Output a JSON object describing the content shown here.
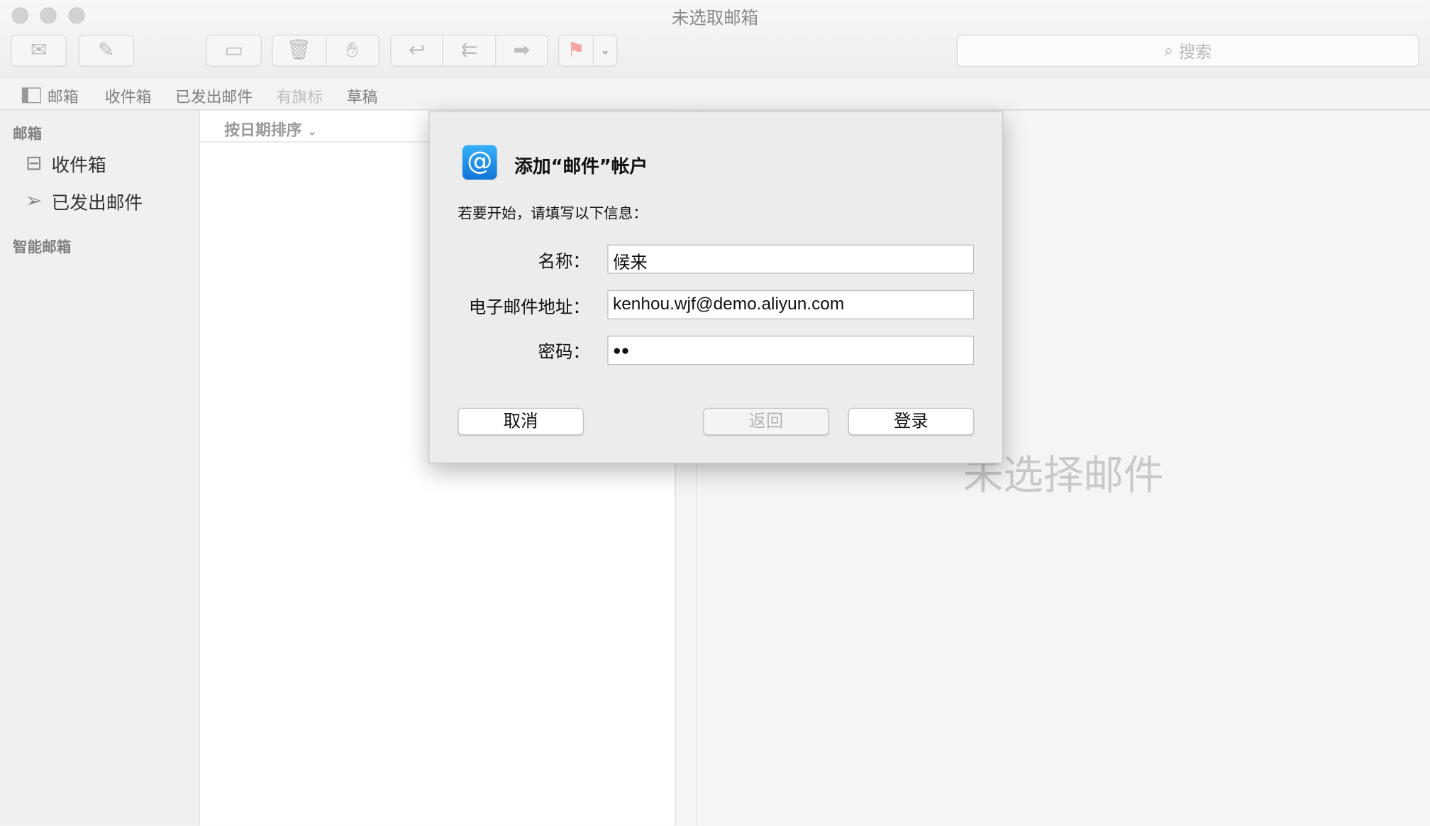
{
  "window": {
    "title": "未选取邮箱"
  },
  "toolbar": {
    "search_placeholder": "搜索",
    "flag_color": "#f26b6b"
  },
  "favorites": {
    "items": [
      {
        "label": "邮箱"
      },
      {
        "label": "收件箱"
      },
      {
        "label": "已发出邮件"
      },
      {
        "label": "有旗标"
      },
      {
        "label": "草稿"
      }
    ]
  },
  "sidebar": {
    "section_mailboxes": "邮箱",
    "items": [
      {
        "label": "收件箱"
      },
      {
        "label": "已发出邮件"
      }
    ],
    "section_smart": "智能邮箱"
  },
  "list": {
    "sort_label": "按日期排序"
  },
  "reader": {
    "empty_text": "未选择邮件"
  },
  "dialog": {
    "title": "添加“邮件”帐户",
    "subtitle": "若要开始，请填写以下信息：",
    "fields": [
      {
        "label": "名称：",
        "value": "候来"
      },
      {
        "label": "电子邮件地址：",
        "value": "kenhou.wjf@demo.aliyun.com"
      },
      {
        "label": "密码：",
        "value": "●●"
      }
    ],
    "cancel": "取消",
    "back": "返回",
    "login": "登录"
  }
}
